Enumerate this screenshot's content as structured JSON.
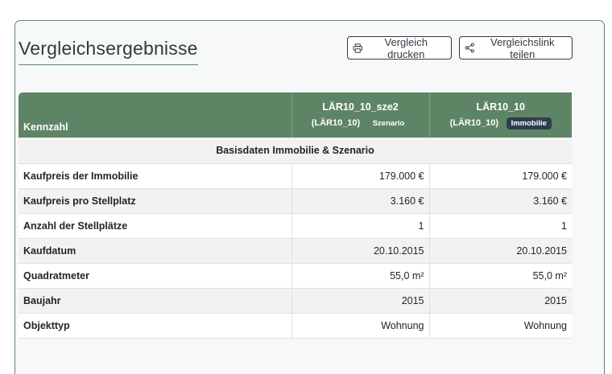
{
  "page": {
    "title": "Vergleichsergebnisse",
    "print_label": "Vergleich drucken",
    "share_label": "Vergleichslink teilen"
  },
  "table": {
    "header": {
      "kennzahl": "Kennzahl",
      "scenario": {
        "name": "LÄR10_10_sze2",
        "sub": "(LÄR10_10)",
        "badge": "Szenario"
      },
      "property": {
        "name": "LÄR10_10",
        "sub": "(LÄR10_10)",
        "badge": "Immobilie"
      }
    },
    "section_title": "Basisdaten Immobilie & Szenario",
    "rows": [
      {
        "label": "Kaufpreis der Immobilie",
        "scenario": "179.000 €",
        "property": "179.000 €"
      },
      {
        "label": "Kaufpreis pro Stellplatz",
        "scenario": "3.160 €",
        "property": "3.160 €"
      },
      {
        "label": "Anzahl der Stellplätze",
        "scenario": "1",
        "property": "1"
      },
      {
        "label": "Kaufdatum",
        "scenario": "20.10.2015",
        "property": "20.10.2015"
      },
      {
        "label": "Quadratmeter",
        "scenario": "55,0 m²",
        "property": "55,0 m²"
      },
      {
        "label": "Baujahr",
        "scenario": "2015",
        "property": "2015"
      },
      {
        "label": "Objekttyp",
        "scenario": "Wohnung",
        "property": "Wohnung"
      }
    ]
  },
  "colors": {
    "header_green": "#5e8466",
    "accent_green": "#5a8a64",
    "badge_dark": "#2c3e50"
  },
  "icons": [
    "printer-icon",
    "share-icon"
  ]
}
